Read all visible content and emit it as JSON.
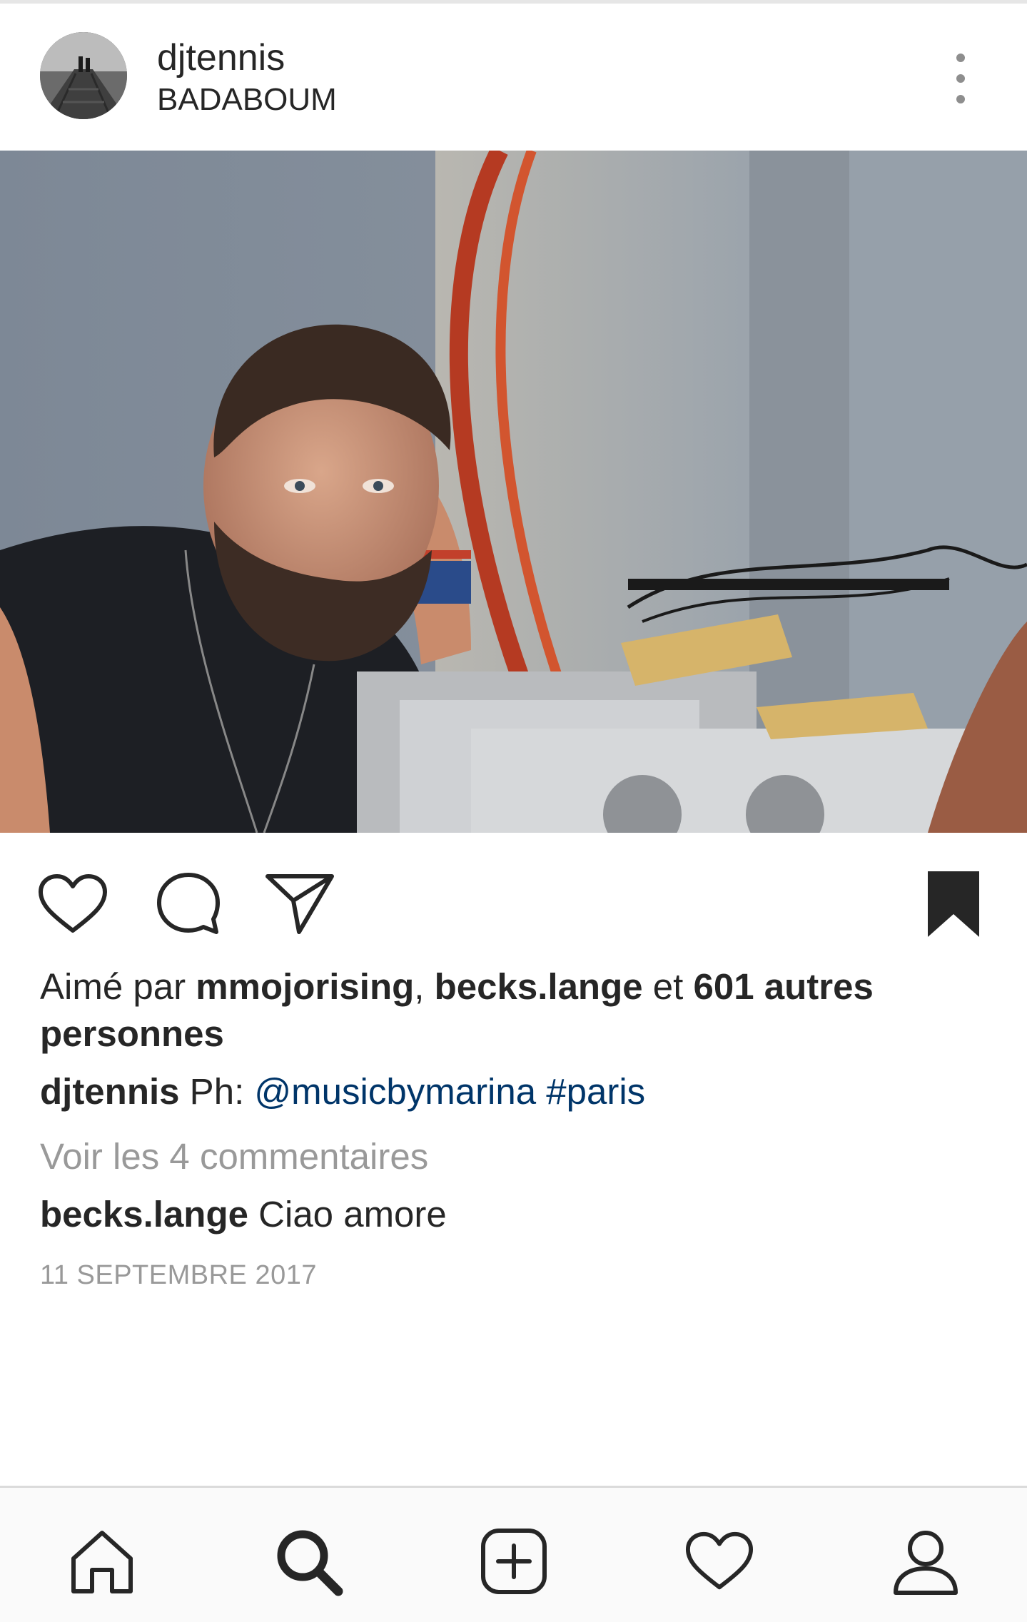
{
  "post": {
    "username": "djtennis",
    "location": "BADABOUM",
    "likes": {
      "prefix": "Aimé par ",
      "user1": "mmojorising",
      "sep": ", ",
      "user2": "becks.lange",
      "conj": " et ",
      "others": "601 autres personnes"
    },
    "caption": {
      "author": "djtennis",
      "text": " Ph: ",
      "mention": "@musicbymarina",
      "space": " ",
      "hashtag": "#paris"
    },
    "view_comments": "Voir les 4 commentaires",
    "comment": {
      "author": "becks.lange",
      "text": " Ciao amore"
    },
    "date": "11 SEPTEMBRE 2017"
  },
  "icons": {
    "more": "more-vertical-icon",
    "like": "heart-outline-icon",
    "comment": "comment-bubble-icon",
    "share": "send-paper-plane-icon",
    "save": "bookmark-filled-icon",
    "nav_home": "home-icon",
    "nav_search": "search-icon",
    "nav_add": "add-post-icon",
    "nav_activity": "heart-outline-icon",
    "nav_profile": "profile-icon"
  },
  "colors": {
    "text": "#262626",
    "muted": "#999999",
    "link": "#003569",
    "nav_bg": "#fafafa"
  }
}
